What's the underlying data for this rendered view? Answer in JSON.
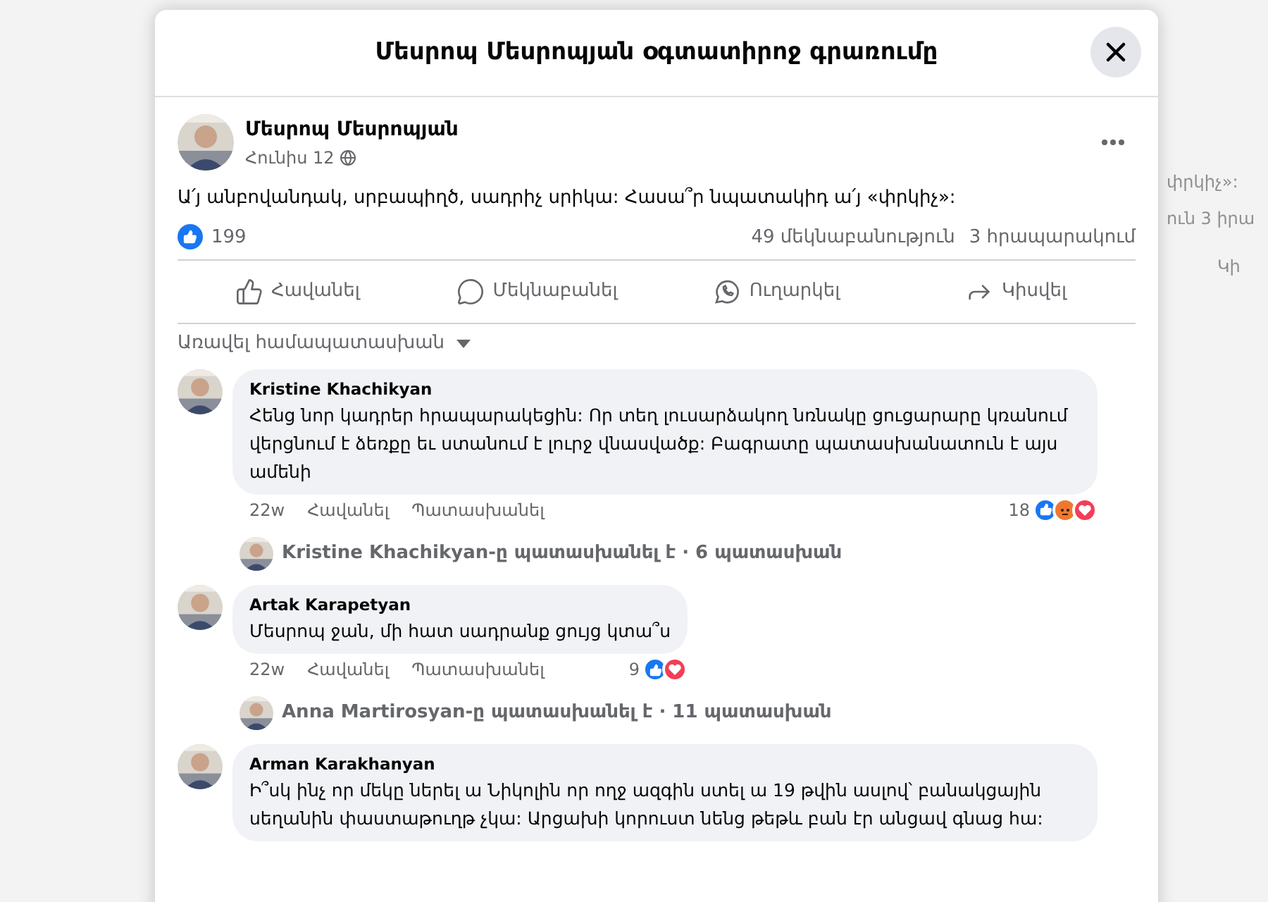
{
  "background": {
    "texts": [
      "փրկիչ»:",
      "ուն  3 իրա",
      "Կի"
    ]
  },
  "modal": {
    "title": "Մեսրոպ Մեսրոպյան օգտատիրոջ գրառումը"
  },
  "post": {
    "author": "Մեսրոպ Մեսրոպյան",
    "date": "Հունիս 12",
    "text": "Ա՛յ անբովանդակ, սրբապիղծ, սադրիչ սրիկա: Հասա՞ր նպատակիդ ա՛յ «փրկիչ»:",
    "likes": "199",
    "comments_count": "49 մեկնաբանություն",
    "shares_count": "3 հրապարակում"
  },
  "actions": [
    {
      "kind": "like",
      "label": "Հավանել"
    },
    {
      "kind": "comment",
      "label": "Մեկնաբանել"
    },
    {
      "kind": "whatsapp",
      "label": "Ուղարկել"
    },
    {
      "kind": "share",
      "label": "Կիսվել"
    }
  ],
  "sort": {
    "label": "Առավել համապատասխան"
  },
  "thread": [
    {
      "kind": "comment",
      "author": "Kristine Khachikyan",
      "text": "Հենց նոր կադրեր հրապարակեցին: Որ տեղ լուսարձակող նռնակը ցուցարարը կռանում վերցնում է ձեռքը եւ ստանում է լուրջ վնասվածք: Բագրատը պատասխանատուն է այս ամենի",
      "time": "22w",
      "like": "Հավանել",
      "reply": "Պատասխանել",
      "count": "18",
      "reactions": [
        {
          "kind": "like"
        },
        {
          "kind": "angry"
        },
        {
          "kind": "love"
        }
      ]
    },
    {
      "kind": "replies",
      "text": "Kristine Khachikyan-ը պատասխանել է · 6 պատասխան"
    },
    {
      "kind": "comment",
      "author": "Artak Karapetyan",
      "text": "Մեսրոպ ջան, մի հատ սադրանք ցույց կտա՞ս",
      "time": "22w",
      "like": "Հավանել",
      "reply": "Պատասխանել",
      "count": "9",
      "reactions": [
        {
          "kind": "like"
        },
        {
          "kind": "love"
        }
      ]
    },
    {
      "kind": "replies",
      "text": "Anna Martirosyan-ը պատասխանել է · 11 պատասխան"
    },
    {
      "kind": "comment",
      "author": "Arman Karakhanyan",
      "text": "Ի՞սկ ինչ որ մեկը ներել ա Նիկոլին որ ողջ ազգին ստել ա 19 թվին ասլով՝ բանակցային սեղանին փաստաթուղթ չկա: Արցախի կորուստ նենց թեթև բան էր անցավ գնաց հա:"
    }
  ]
}
